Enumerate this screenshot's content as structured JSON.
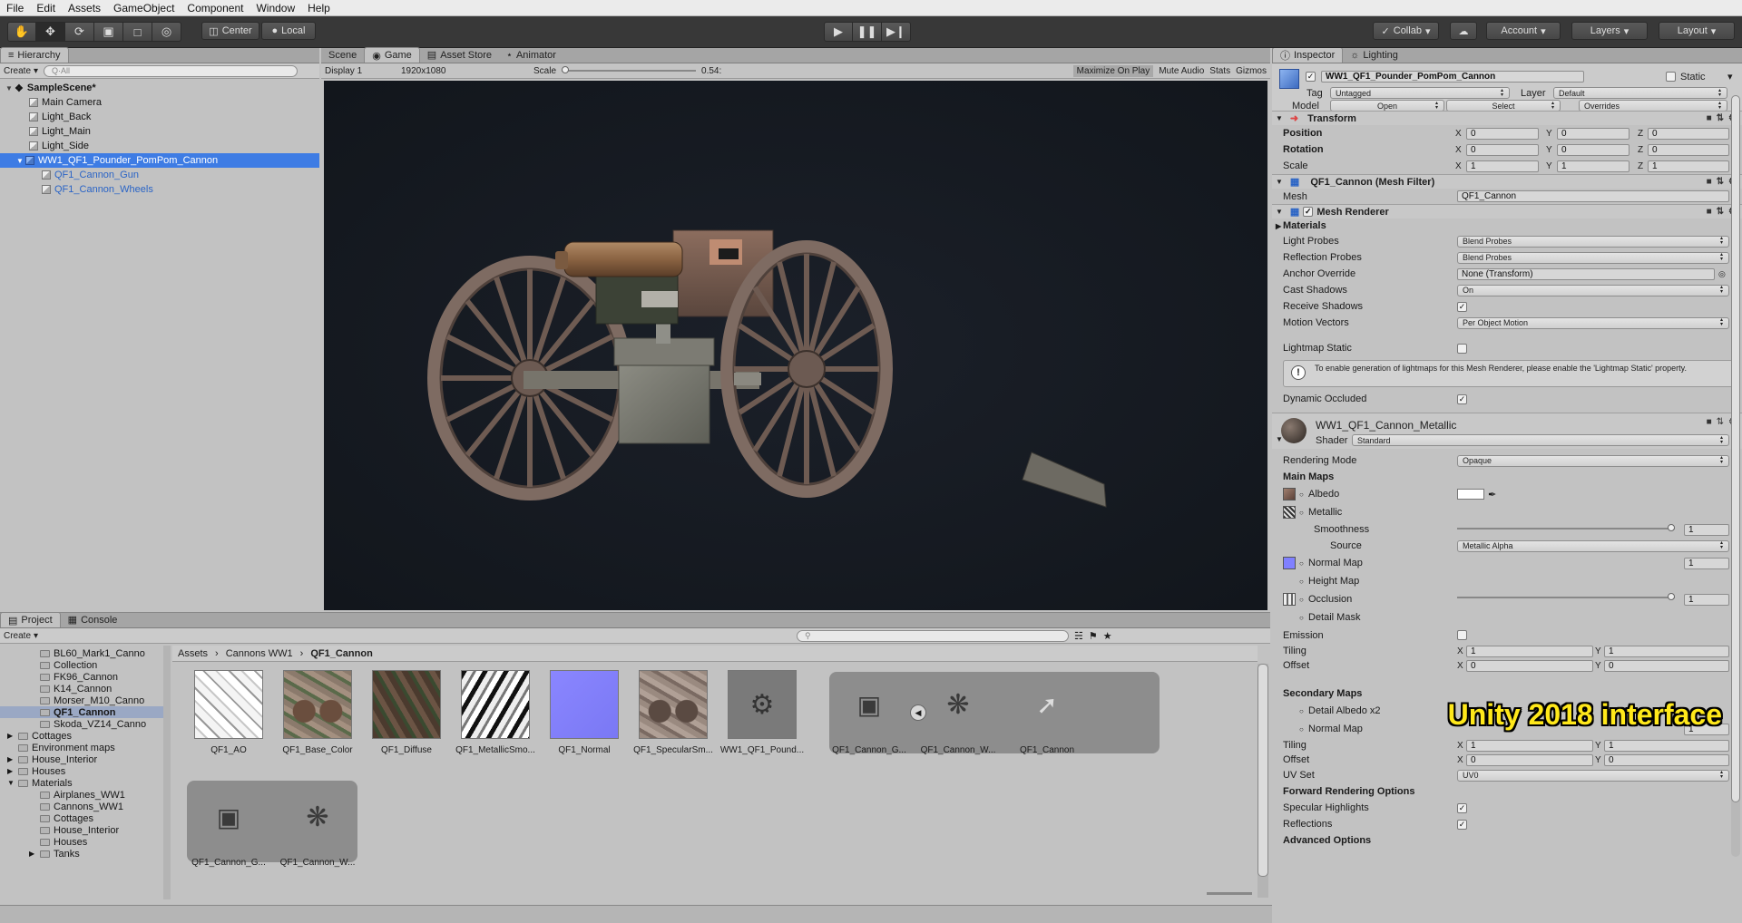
{
  "menu": [
    "File",
    "Edit",
    "Assets",
    "GameObject",
    "Component",
    "Window",
    "Help"
  ],
  "toolbar": {
    "pivot_label": "Center",
    "space_label": "Local",
    "collab_label": "Collab",
    "account_label": "Account",
    "layers_label": "Layers",
    "layout_label": "Layout"
  },
  "hierarchy": {
    "tab": "Hierarchy",
    "create": "Create",
    "search_placeholder": "Q·All",
    "scene": "SampleScene*",
    "items": [
      {
        "label": "Main Camera"
      },
      {
        "label": "Light_Back"
      },
      {
        "label": "Light_Main"
      },
      {
        "label": "Light_Side"
      },
      {
        "label": "WW1_QF1_Pounder_PomPom_Cannon"
      },
      {
        "label": "QF1_Cannon_Gun"
      },
      {
        "label": "QF1_Cannon_Wheels"
      }
    ]
  },
  "center_tabs": [
    "Scene",
    "Game",
    "Asset Store",
    "Animator"
  ],
  "game_bar": {
    "display": "Display 1",
    "resolution": "1920x1080",
    "scale_label": "Scale",
    "scale_value": "0.54:",
    "maximize": "Maximize On Play",
    "mute": "Mute Audio",
    "stats": "Stats",
    "gizmos": "Gizmos"
  },
  "inspector": {
    "tabs": [
      "Inspector",
      "Lighting"
    ],
    "object_name": "WW1_QF1_Pounder_PomPom_Cannon",
    "static_label": "Static",
    "tag_label": "Tag",
    "tag_value": "Untagged",
    "layer_label": "Layer",
    "layer_value": "Default",
    "model_label": "Model",
    "open": "Open",
    "select": "Select",
    "overrides": "Overrides",
    "transform": {
      "title": "Transform",
      "position": "Position",
      "rotation": "Rotation",
      "scale": "Scale",
      "x": "X",
      "y": "Y",
      "z": "Z",
      "pos": [
        "0",
        "0",
        "0"
      ],
      "rot": [
        "0",
        "0",
        "0"
      ],
      "scl": [
        "1",
        "1",
        "1"
      ]
    },
    "mesh_filter": {
      "title": "QF1_Cannon (Mesh Filter)",
      "mesh_label": "Mesh",
      "mesh_value": "QF1_Cannon"
    },
    "mesh_renderer": {
      "title": "Mesh Renderer",
      "materials": "Materials",
      "light_probes": "Light Probes",
      "light_probes_value": "Blend Probes",
      "reflection_probes": "Reflection Probes",
      "reflection_probes_value": "Blend Probes",
      "anchor_override": "Anchor Override",
      "anchor_override_value": "None (Transform)",
      "cast_shadows": "Cast Shadows",
      "cast_shadows_value": "On",
      "receive_shadows": "Receive Shadows",
      "motion_vectors": "Motion Vectors",
      "motion_vectors_value": "Per Object Motion",
      "lightmap_static": "Lightmap Static",
      "info": "To enable generation of lightmaps for this Mesh Renderer, please enable the 'Lightmap Static' property.",
      "dynamic_occluded": "Dynamic Occluded"
    },
    "material": {
      "name": "WW1_QF1_Cannon_Metallic",
      "shader_label": "Shader",
      "shader_value": "Standard",
      "rendering_mode": "Rendering Mode",
      "rendering_mode_value": "Opaque",
      "main_maps": "Main Maps",
      "albedo": "Albedo",
      "metallic": "Metallic",
      "smoothness": "Smoothness",
      "smoothness_value": "1",
      "source": "Source",
      "source_value": "Metallic Alpha",
      "normal_map": "Normal Map",
      "normal_value": "1",
      "height_map": "Height Map",
      "occlusion": "Occlusion",
      "occlusion_value": "1",
      "detail_mask": "Detail Mask",
      "emission": "Emission",
      "tiling": "Tiling",
      "offset": "Offset",
      "tiling_x": "1",
      "tiling_y": "1",
      "offset_x": "0",
      "offset_y": "0",
      "secondary_maps": "Secondary Maps",
      "detail_albedo": "Detail Albedo x2",
      "normal_map2": "Normal Map",
      "normal_value2": "1",
      "tiling2_x": "1",
      "tiling2_y": "1",
      "offset2_x": "0",
      "offset2_y": "0",
      "uv_set": "UV Set",
      "uv_set_value": "UV0",
      "forward_options": "Forward Rendering Options",
      "specular_highlights": "Specular Highlights",
      "reflections": "Reflections",
      "advanced": "Advanced Options"
    }
  },
  "project": {
    "tabs": [
      "Project",
      "Console"
    ],
    "create": "Create",
    "tree": [
      {
        "label": "BL60_Mark1_Canno",
        "indent": 2
      },
      {
        "label": "Collection",
        "indent": 2
      },
      {
        "label": "FK96_Cannon",
        "indent": 2
      },
      {
        "label": "K14_Cannon",
        "indent": 2
      },
      {
        "label": "Morser_M10_Canno",
        "indent": 2
      },
      {
        "label": "QF1_Cannon",
        "indent": 2,
        "selected": true
      },
      {
        "label": "Skoda_VZ14_Canno",
        "indent": 2
      },
      {
        "label": "Cottages",
        "indent": 1,
        "arrow": true
      },
      {
        "label": "Environment maps",
        "indent": 1
      },
      {
        "label": "House_Interior",
        "indent": 1,
        "arrow": true
      },
      {
        "label": "Houses",
        "indent": 1,
        "arrow": true
      },
      {
        "label": "Materials",
        "indent": 1,
        "open": true
      },
      {
        "label": "Airplanes_WW1",
        "indent": 2
      },
      {
        "label": "Cannons_WW1",
        "indent": 2
      },
      {
        "label": "Cottages",
        "indent": 2
      },
      {
        "label": "House_Interior",
        "indent": 2
      },
      {
        "label": "Houses",
        "indent": 2
      },
      {
        "label": "Tanks",
        "indent": 2,
        "arrow": true
      }
    ],
    "breadcrumb": [
      "Assets",
      "Cannons WW1",
      "QF1_Cannon"
    ],
    "assets": [
      {
        "name": "QF1_AO"
      },
      {
        "name": "QF1_Base_Color"
      },
      {
        "name": "QF1_Diffuse"
      },
      {
        "name": "QF1_MetallicSmo..."
      },
      {
        "name": "QF1_Normal"
      },
      {
        "name": "QF1_SpecularSm..."
      },
      {
        "name": "WW1_QF1_Pound..."
      },
      {
        "name": "QF1_Cannon_G..."
      },
      {
        "name": "QF1_Cannon_W..."
      },
      {
        "name": "QF1_Cannon"
      },
      {
        "name": "QF1_Cannon_G..."
      },
      {
        "name": "QF1_Cannon_W..."
      }
    ]
  },
  "watermark": "Unity 2018 interface"
}
